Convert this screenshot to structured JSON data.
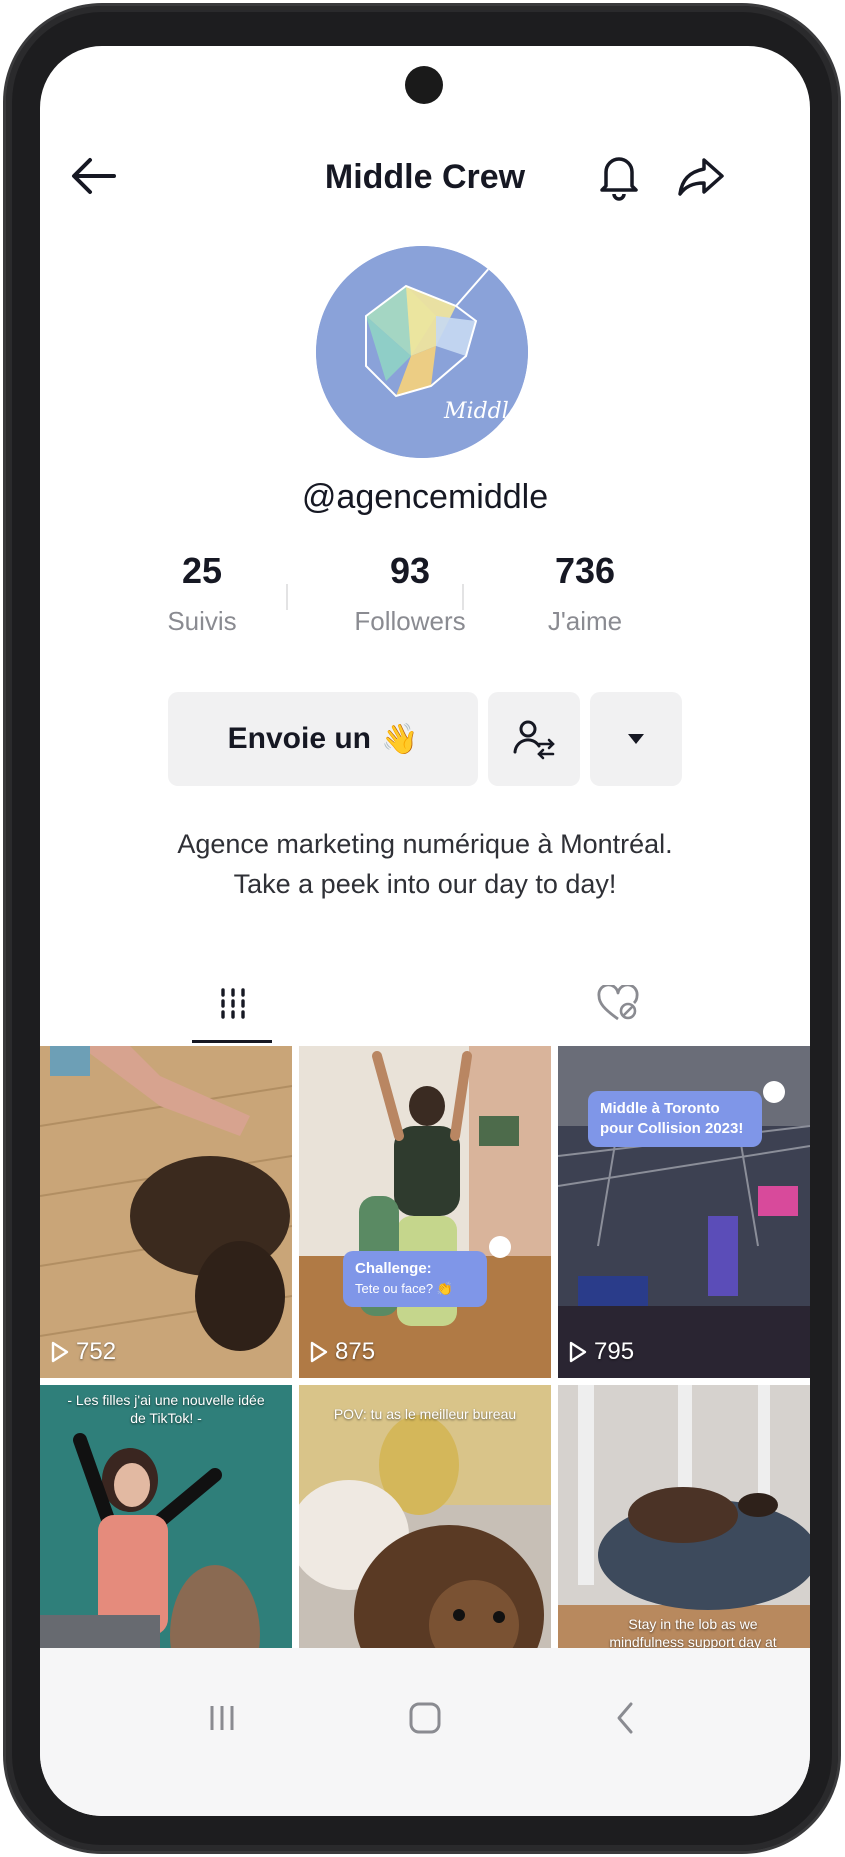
{
  "header": {
    "title": "Middle Crew",
    "back_icon": "arrow-left-icon",
    "bell_icon": "bell-icon",
    "share_icon": "share-arrow-icon"
  },
  "profile": {
    "avatar_caption": "Middle",
    "username": "@agencemiddle",
    "stats": [
      {
        "value": "25",
        "label": "Suivis"
      },
      {
        "value": "93",
        "label": "Followers"
      },
      {
        "value": "736",
        "label": "J'aime"
      }
    ],
    "message_button": "Envoie un",
    "message_emoji": "👋",
    "bio_line1": "Agence marketing numérique à Montréal.",
    "bio_line2": "Take a peek into our day to day!"
  },
  "tabs": [
    {
      "icon": "grid-icon",
      "active": true
    },
    {
      "icon": "liked-heart-icon",
      "active": false
    }
  ],
  "videos": [
    {
      "views": "752"
    },
    {
      "views": "875",
      "label_title": "Challenge:",
      "label_sub": "Tete ou face? 👏"
    },
    {
      "views": "795",
      "label_title": "Middle à Toronto pour Collision 2023!"
    },
    {
      "caption": "- Les filles j'ai une nouvelle idée de TikTok! -"
    },
    {
      "caption": "POV: tu as le meilleur bureau"
    },
    {
      "caption": "Stay in the lob as we mindfulness support day at Middle"
    }
  ],
  "colors": {
    "accent_label": "#7f96e8",
    "avatar_bg": "#8aa2d9",
    "text_primary": "#161823",
    "text_secondary": "#8a8b91"
  }
}
